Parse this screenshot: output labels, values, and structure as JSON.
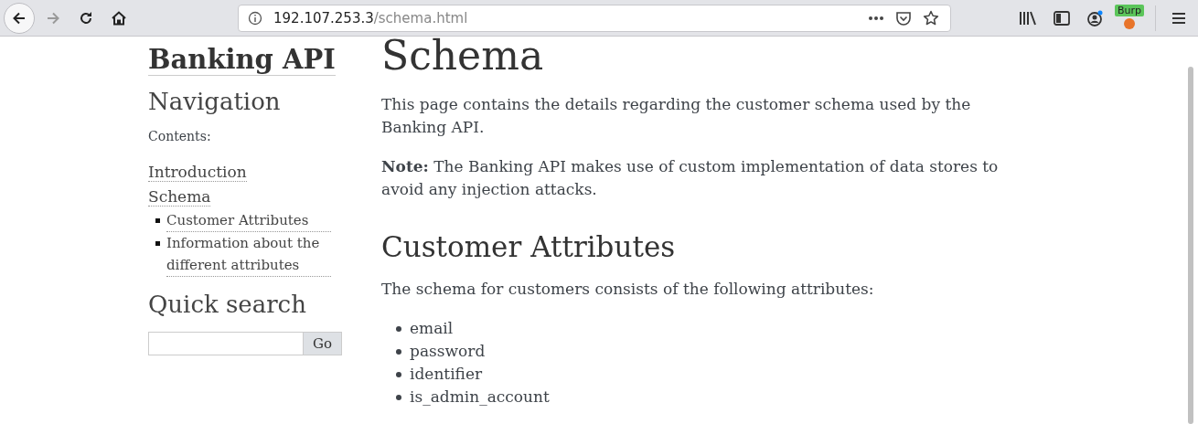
{
  "browser": {
    "url_host": "192.107.253.3",
    "url_path": "/schema.html",
    "extension_badge": "Burp",
    "back_enabled": true,
    "forward_enabled": false
  },
  "sidebar": {
    "logo": "Banking API",
    "navigation_title": "Navigation",
    "contents_caption": "Contents:",
    "toc": [
      {
        "label": "Introduction"
      },
      {
        "label": "Schema",
        "children": [
          {
            "label": "Customer Attributes"
          },
          {
            "label": "Information about the different attributes"
          }
        ]
      }
    ],
    "quick_search_title": "Quick search",
    "search_button": "Go"
  },
  "main": {
    "title": "Schema",
    "paragraphs": [
      "This page contains the details regarding the customer schema used by the Banking API.",
      "**Note:** The Banking API makes use of custom implementation of data stores to avoid any injection attacks."
    ],
    "section_title": "Customer Attributes",
    "section_intro": "The schema for customers consists of the following attributes:",
    "attributes": [
      "email",
      "password",
      "identifier",
      "is_admin_account"
    ]
  }
}
